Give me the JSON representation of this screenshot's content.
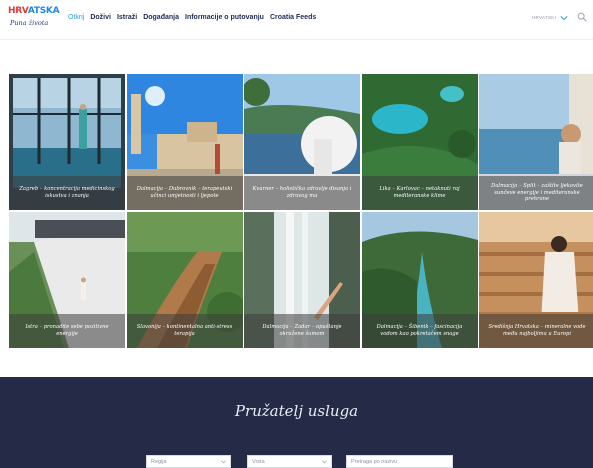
{
  "header": {
    "logo": {
      "word_part1": "HRV",
      "word_part2": "ATSKA",
      "tagline": "Puna života"
    },
    "nav": [
      {
        "label": "Otkrij",
        "active": true
      },
      {
        "label": "Doživi",
        "active": false
      },
      {
        "label": "Istraži",
        "active": false
      },
      {
        "label": "Događanja",
        "active": false
      },
      {
        "label": "Informacije o putovanju",
        "active": false
      },
      {
        "label": "Croatia Feeds",
        "active": false
      }
    ],
    "language": "HRVATSKI",
    "accent_color": "#2aa6e0"
  },
  "tiles": [
    {
      "caption": "Zagreb – koncentracija medicinskog iskustva i znanja"
    },
    {
      "caption": "Dalmacija – Dubrovnik – terapeutski učinci umjetnosti i ljepote"
    },
    {
      "caption": "Kvarner – holistička zdravlje disanja i zdravog ma"
    },
    {
      "caption": "Lika – Karlovac – netaknuti raj mediteranske klime"
    },
    {
      "caption": "Dalmacija – Split – zaštite ljekovite sunčeve energije i mediteranske prehrane"
    },
    {
      "caption": "Istra – pronađite sebe pozitivne energije"
    },
    {
      "caption": "Slavonija – kontinentalna anti-stress terapija"
    },
    {
      "caption": "Dalmacija – Zadar – opuštanje okružene šumom"
    },
    {
      "caption": "Dalmacija – Šibenik – fascinacija vodom kao pokretačem snage"
    },
    {
      "caption": "Središnja Hrvatska – mineralne vode među najboljima u Europi"
    }
  ],
  "provider": {
    "title": "Pružatelj usluga",
    "region_placeholder": "Regija",
    "type_placeholder": "Vrsta",
    "search_placeholder": "Pretraga po nazivu",
    "bg_color": "#252b46"
  }
}
